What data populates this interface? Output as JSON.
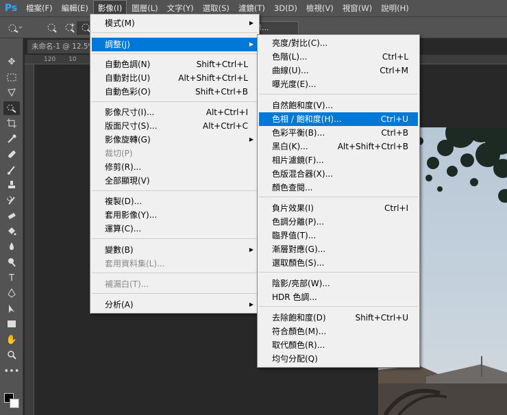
{
  "menubar": {
    "logo": "Ps",
    "items": [
      "檔案(F)",
      "編輯(E)",
      "影像(I)",
      "圖層(L)",
      "文字(Y)",
      "選取(S)",
      "濾鏡(T)",
      "3D(D)",
      "檢視(V)",
      "視窗(W)",
      "說明(H)"
    ]
  },
  "options": {
    "button_label": "緣..."
  },
  "document": {
    "tab": "未命名-1 @ 12.5%",
    "ruler_ticks": [
      "120",
      "10"
    ]
  },
  "main_menu": [
    {
      "label": "模式(M)",
      "submenu": true
    },
    {
      "label": "調整(J)",
      "submenu": true
    },
    {
      "label": "自動色調(N)",
      "shortcut": "Shift+Ctrl+L"
    },
    {
      "label": "自動對比(U)",
      "shortcut": "Alt+Shift+Ctrl+L"
    },
    {
      "label": "自動色彩(O)",
      "shortcut": "Shift+Ctrl+B"
    },
    {
      "label": "影像尺寸(I)...",
      "shortcut": "Alt+Ctrl+I"
    },
    {
      "label": "版面尺寸(S)...",
      "shortcut": "Alt+Ctrl+C"
    },
    {
      "label": "影像旋轉(G)",
      "submenu": true
    },
    {
      "label": "裁切(P)",
      "disabled": true
    },
    {
      "label": "修剪(R)..."
    },
    {
      "label": "全部顯現(V)"
    },
    {
      "label": "複製(D)..."
    },
    {
      "label": "套用影像(Y)..."
    },
    {
      "label": "運算(C)..."
    },
    {
      "label": "變數(B)",
      "submenu": true
    },
    {
      "label": "套用資料集(L)...",
      "disabled": true
    },
    {
      "label": "補漏白(T)...",
      "disabled": true
    },
    {
      "label": "分析(A)",
      "submenu": true
    }
  ],
  "sub_menu": [
    {
      "label": "亮度/對比(C)..."
    },
    {
      "label": "色階(L)...",
      "shortcut": "Ctrl+L"
    },
    {
      "label": "曲線(U)...",
      "shortcut": "Ctrl+M"
    },
    {
      "label": "曝光度(E)..."
    },
    {
      "label": "自然飽和度(V)..."
    },
    {
      "label": "色相 / 飽和度(H)...",
      "shortcut": "Ctrl+U"
    },
    {
      "label": "色彩平衡(B)...",
      "shortcut": "Ctrl+B"
    },
    {
      "label": "黑白(K)...",
      "shortcut": "Alt+Shift+Ctrl+B"
    },
    {
      "label": "相片濾鏡(F)..."
    },
    {
      "label": "色版混合器(X)..."
    },
    {
      "label": "顏色查閱..."
    },
    {
      "label": "負片效果(I)",
      "shortcut": "Ctrl+I"
    },
    {
      "label": "色調分離(P)..."
    },
    {
      "label": "臨界值(T)..."
    },
    {
      "label": "漸層對應(G)..."
    },
    {
      "label": "選取顏色(S)..."
    },
    {
      "label": "陰影/亮部(W)..."
    },
    {
      "label": "HDR 色調..."
    },
    {
      "label": "去除飽和度(D)",
      "shortcut": "Shift+Ctrl+U"
    },
    {
      "label": "符合顏色(M)..."
    },
    {
      "label": "取代顏色(R)..."
    },
    {
      "label": "均勻分配(Q)"
    }
  ],
  "colors": {
    "highlight": "#0078d7",
    "app_bg": "#282828",
    "panel": "#535353"
  }
}
